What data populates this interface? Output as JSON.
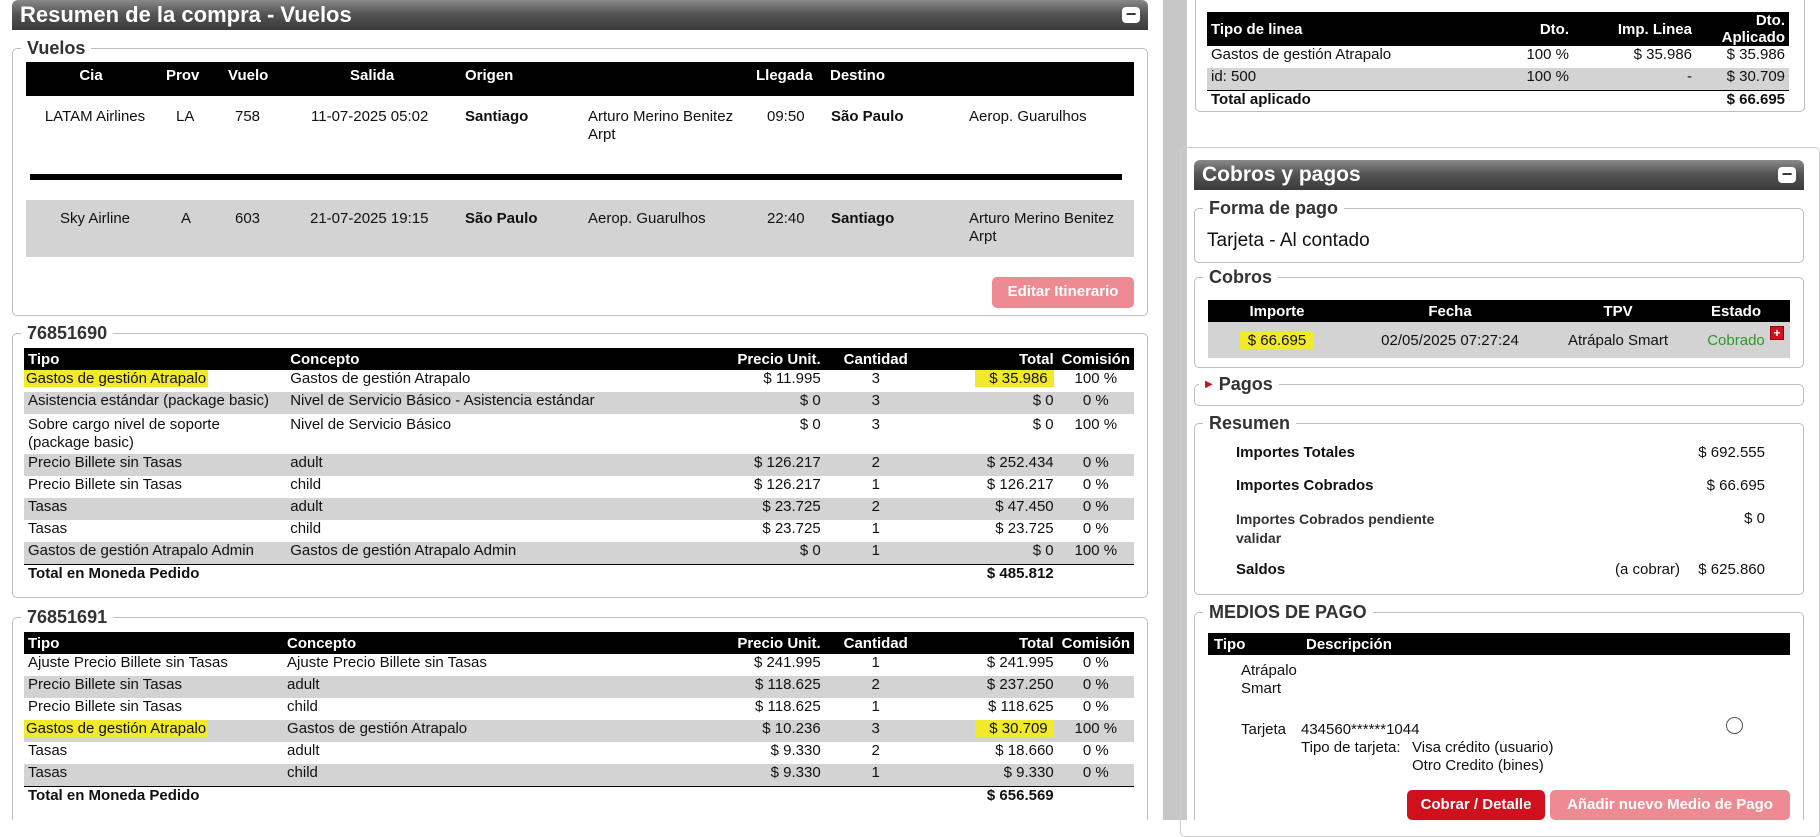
{
  "left": {
    "header_title": "Resumen de la compra - Vuelos",
    "collapse_label": "−",
    "vuelos": {
      "legend": "Vuelos",
      "columns": [
        "Cia",
        "Prov",
        "Vuelo",
        "Salida",
        "Origen",
        "",
        "Llegada",
        "Destino",
        ""
      ],
      "rows": [
        {
          "cia": "LATAM Airlines",
          "prov": "LA",
          "vuelo": "758",
          "salida": "11-07-2025 05:02",
          "origen": "Santiago",
          "origen_aero": "Arturo Merino Benitez Arpt",
          "llegada": "09:50",
          "destino": "São Paulo",
          "destino_aero": "Aerop. Guarulhos"
        },
        {
          "cia": "Sky Airline",
          "prov": "A",
          "vuelo": "603",
          "salida": "21-07-2025 19:15",
          "origen": "São Paulo",
          "origen_aero": "Aerop. Guarulhos",
          "llegada": "22:40",
          "destino": "Santiago",
          "destino_aero": "Arturo Merino Benitez Arpt"
        }
      ],
      "edit_button": "Editar Itinerario"
    },
    "order1": {
      "legend": "76851690",
      "columns": [
        "Tipo",
        "Concepto",
        "Precio Unit.",
        "Cantidad",
        "Total",
        "Comisión"
      ],
      "rows": [
        {
          "tipo": "Gastos de gestión Atrapalo",
          "concepto": "Gastos de gestión Atrapalo",
          "precio": "$ 11.995",
          "cantidad": "3",
          "total": "$ 35.986",
          "comision": "100 %"
        },
        {
          "tipo": "Asistencia estándar (package basic)",
          "concepto": "Nivel de Servicio Básico - Asistencia estándar",
          "precio": "$ 0",
          "cantidad": "3",
          "total": "$ 0",
          "comision": "0 %"
        },
        {
          "tipo": "Sobre cargo nivel de soporte (package basic)",
          "concepto": "Nivel de Servicio Básico",
          "precio": "$ 0",
          "cantidad": "3",
          "total": "$ 0",
          "comision": "100 %"
        },
        {
          "tipo": "Precio Billete sin Tasas",
          "concepto": "adult",
          "precio": "$ 126.217",
          "cantidad": "2",
          "total": "$ 252.434",
          "comision": "0 %"
        },
        {
          "tipo": "Precio Billete sin Tasas",
          "concepto": "child",
          "precio": "$ 126.217",
          "cantidad": "1",
          "total": "$ 126.217",
          "comision": "0 %"
        },
        {
          "tipo": "Tasas",
          "concepto": "adult",
          "precio": "$ 23.725",
          "cantidad": "2",
          "total": "$ 47.450",
          "comision": "0 %"
        },
        {
          "tipo": "Tasas",
          "concepto": "child",
          "precio": "$ 23.725",
          "cantidad": "1",
          "total": "$ 23.725",
          "comision": "0 %"
        },
        {
          "tipo": "Gastos de gestión Atrapalo Admin",
          "concepto": "Gastos de gestión Atrapalo Admin",
          "precio": "$ 0",
          "cantidad": "1",
          "total": "$ 0",
          "comision": "100 %"
        }
      ],
      "total_label": "Total en Moneda Pedido",
      "total_value": "$ 485.812"
    },
    "order2": {
      "legend": "76851691",
      "columns": [
        "Tipo",
        "Concepto",
        "Precio Unit.",
        "Cantidad",
        "Total",
        "Comisión"
      ],
      "rows": [
        {
          "tipo": "Ajuste Precio Billete sin Tasas",
          "concepto": "Ajuste Precio Billete sin Tasas",
          "precio": "$ 241.995",
          "cantidad": "1",
          "total": "$ 241.995",
          "comision": "0 %"
        },
        {
          "tipo": "Precio Billete sin Tasas",
          "concepto": "adult",
          "precio": "$ 118.625",
          "cantidad": "2",
          "total": "$ 237.250",
          "comision": "0 %"
        },
        {
          "tipo": "Precio Billete sin Tasas",
          "concepto": "child",
          "precio": "$ 118.625",
          "cantidad": "1",
          "total": "$ 118.625",
          "comision": "0 %"
        },
        {
          "tipo": "Gastos de gestión Atrapalo",
          "concepto": "Gastos de gestión Atrapalo",
          "precio": "$ 10.236",
          "cantidad": "3",
          "total": "$ 30.709",
          "comision": "100 %"
        },
        {
          "tipo": "Tasas",
          "concepto": "adult",
          "precio": "$ 9.330",
          "cantidad": "2",
          "total": "$ 18.660",
          "comision": "0 %"
        },
        {
          "tipo": "Tasas",
          "concepto": "child",
          "precio": "$ 9.330",
          "cantidad": "1",
          "total": "$ 9.330",
          "comision": "0 %"
        }
      ],
      "total_label": "Total en Moneda Pedido",
      "total_value": "$ 656.569"
    }
  },
  "right": {
    "discounts": {
      "columns": [
        "Tipo de linea",
        "Dto.",
        "Imp. Linea",
        "Dto. Aplicado"
      ],
      "rows": [
        {
          "tipo": "Gastos de gestión Atrapalo",
          "dto": "100 %",
          "imp": "$ 35.986",
          "aplicado": "$ 35.986"
        },
        {
          "tipo": "id: 500",
          "dto": "100 %",
          "imp": "-",
          "aplicado": "$ 30.709"
        }
      ],
      "total_label": "Total aplicado",
      "total_value": "$ 66.695"
    },
    "cobros_header": "Cobros y pagos",
    "forma_pago": {
      "legend": "Forma de pago",
      "value": "Tarjeta - Al contado"
    },
    "cobros": {
      "legend": "Cobros",
      "columns": [
        "Importe",
        "Fecha",
        "TPV",
        "Estado"
      ],
      "row": {
        "importe": "$ 66.695",
        "fecha": "02/05/2025 07:27:24",
        "tpv": "Atrápalo Smart",
        "estado": "Cobrado"
      },
      "add_icon": "+"
    },
    "pagos": {
      "legend": "Pagos",
      "arrow": "▶"
    },
    "resumen": {
      "legend": "Resumen",
      "totales_label": "Importes Totales",
      "totales_value": "$ 692.555",
      "cobrados_label": "Importes Cobrados",
      "cobrados_value": "$ 66.695",
      "pendiente_label": "Importes Cobrados pendiente validar",
      "pendiente_value": "$ 0",
      "saldos_label": "Saldos",
      "saldos_note": "(a cobrar)",
      "saldos_value": "$ 625.860"
    },
    "medios": {
      "legend": "MEDIOS DE PAGO",
      "columns": [
        "Tipo",
        "Descripción"
      ],
      "atrapalo_tipo": "Atrápalo Smart",
      "tarjeta_tipo": "Tarjeta",
      "card_number": "434560******1044",
      "card_type_label": "Tipo de tarjeta:",
      "card_type_1": "Visa crédito (usuario)",
      "card_type_2": "Otro Credito (bines)",
      "cobrar_button": "Cobrar / Detalle",
      "nuevo_button": "Añadir nuevo Medio de Pago"
    },
    "colors": {
      "primary_red": "#d0101d",
      "light_red": "#ee8a92",
      "highlight": "#f1ea2a",
      "green": "#2a9a2a"
    }
  }
}
